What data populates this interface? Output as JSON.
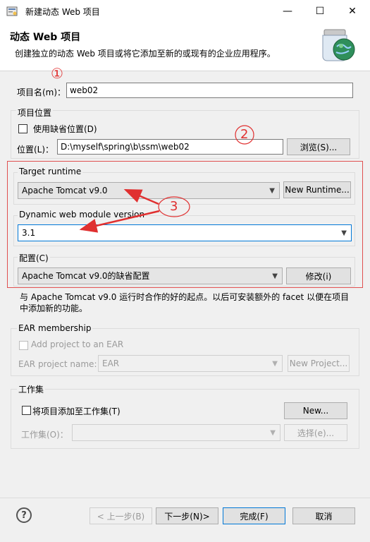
{
  "window": {
    "title": "新建动态 Web 项目",
    "minimize_glyph": "—",
    "maximize_glyph": "☐",
    "close_glyph": "✕"
  },
  "header": {
    "title": "动态 Web 项目",
    "description": "创建独立的动态 Web 项目或将它添加至新的或现有的企业应用程序。",
    "icon": "globe-jar-icon"
  },
  "annotations": {
    "one": "①",
    "two": "2",
    "three": "3",
    "color": "#e03030"
  },
  "project_name": {
    "label": "项目名(m)：",
    "value": "web02"
  },
  "location": {
    "group_label": "项目位置",
    "use_default_label": "使用缺省位置(D)",
    "use_default_checked": false,
    "path_label": "位置(L)：",
    "path_value": "D:\\myself\\spring\\b\\ssm\\web02",
    "browse_label": "浏览(S)..."
  },
  "target_runtime": {
    "group_label": "Target runtime",
    "selected": "Apache Tomcat v9.0",
    "new_runtime_label": "New Runtime..."
  },
  "module_version": {
    "group_label": "Dynamic web module version",
    "selected": "3.1"
  },
  "configuration": {
    "group_label": "配置(C)",
    "selected": "Apache Tomcat v9.0的缺省配置",
    "modify_label": "修改(i)",
    "description_line1": "与 Apache Tomcat v9.0 运行时合作的好的起点。以后可安装额外的 facet 以便在项目",
    "description_line2": "中添加新的功能。"
  },
  "ear": {
    "group_label": "EAR membership",
    "add_label": "Add project to an EAR",
    "project_name_label": "EAR project name:",
    "project_name_value": "EAR",
    "new_project_label": "New Project..."
  },
  "working_set": {
    "group_label": "工作集",
    "add_label": "将项目添加至工作集(T)",
    "new_label": "New...",
    "sets_label": "工作集(O)：",
    "sets_value": "",
    "select_label": "选择(e)..."
  },
  "footer": {
    "help_glyph": "?",
    "back_label": "< 上一步(B)",
    "next_label": "下一步(N)>",
    "finish_label": "完成(F)",
    "cancel_label": "取消"
  },
  "colors": {
    "accent": "#0078d7",
    "highlight_box": "#e05050"
  }
}
